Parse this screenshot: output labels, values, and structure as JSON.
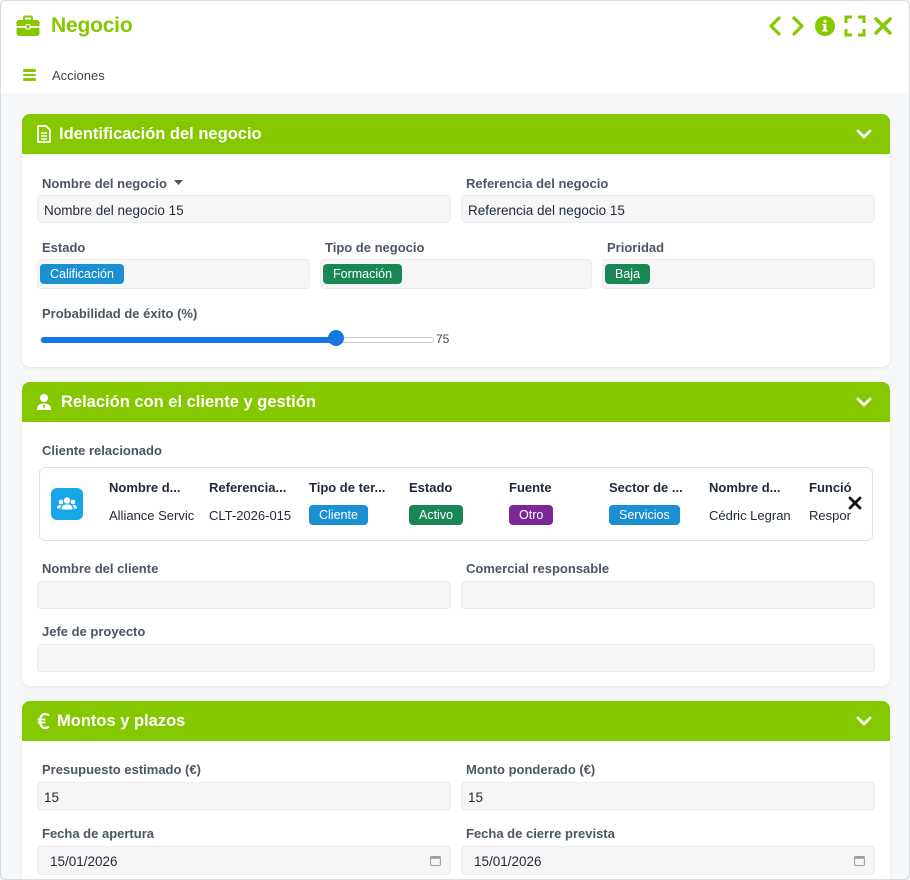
{
  "window": {
    "title": "Negocio",
    "accent_color": "#86c800",
    "buttons": [
      "chevron-left-icon",
      "chevron-right-icon",
      "info-icon",
      "fullscreen-icon",
      "close-icon"
    ]
  },
  "toolbar": {
    "actions_label": "Acciones"
  },
  "section1": {
    "title": "Identificación del negocio",
    "nombre_label": "Nombre del negocio",
    "nombre_value": "Nombre del negocio 15",
    "referencia_label": "Referencia del negocio",
    "referencia_value": "Referencia del negocio 15",
    "estado_label": "Estado",
    "estado_tag": "Calificación",
    "estado_color": "#1a8fd1",
    "tipo_label": "Tipo de negocio",
    "tipo_tag": "Formación",
    "tipo_color": "#198754",
    "prioridad_label": "Prioridad",
    "prioridad_tag": "Baja",
    "prioridad_color": "#198754",
    "probabilidad_label": "Probabilidad de éxito (%)",
    "probabilidad_value": "75",
    "probabilidad_fraction": 0.75
  },
  "section2": {
    "title": "Relación con el cliente y gestión",
    "cliente_label": "Cliente relacionado",
    "related": {
      "columns": [
        {
          "header": "Nombre d...",
          "value": "Alliance Servic"
        },
        {
          "header": "Referencia...",
          "value": "CLT-2026-015"
        },
        {
          "header": "Tipo de ter...",
          "tag": "Cliente",
          "color": "#1a8fd1"
        },
        {
          "header": "Estado",
          "tag": "Activo",
          "color": "#198754"
        },
        {
          "header": "Fuente",
          "tag": "Otro",
          "color": "#7b2896"
        },
        {
          "header": "Sector de ...",
          "tag": "Servicios",
          "color": "#1a8fd1"
        },
        {
          "header": "Nombre d...",
          "value": "Cédric Legran"
        },
        {
          "header": "Funció",
          "value": "Respor"
        }
      ]
    },
    "nombre_cliente_label": "Nombre del cliente",
    "nombre_cliente_value": "",
    "comercial_label": "Comercial responsable",
    "comercial_value": "",
    "jefe_label": "Jefe de proyecto",
    "jefe_value": ""
  },
  "section3": {
    "title": "Montos y plazos",
    "presupuesto_label": "Presupuesto estimado (€)",
    "presupuesto_value": "15",
    "monto_label": "Monto ponderado (€)",
    "monto_value": "15",
    "apertura_label": "Fecha de apertura",
    "apertura_value": "15/01/2026",
    "cierre_label": "Fecha de cierre prevista",
    "cierre_value": "15/01/2026"
  }
}
